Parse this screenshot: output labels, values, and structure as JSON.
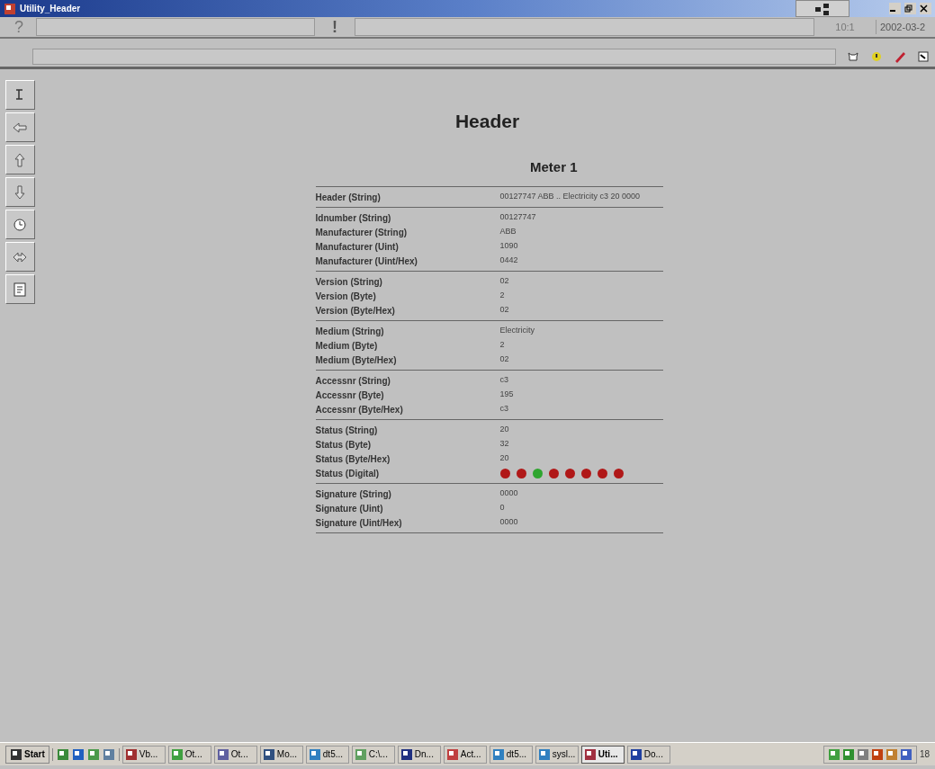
{
  "window": {
    "title": "Utility_Header"
  },
  "toolbar": {
    "help": "?",
    "alert": "!",
    "time": "10:1",
    "date": "2002-03-2"
  },
  "page": {
    "title": "Header",
    "subtitle": "Meter 1"
  },
  "sections": [
    {
      "rows": [
        {
          "kind": "text",
          "label": "Header (String)",
          "value": "00127747 ABB .. Electricity c3 20 0000"
        }
      ]
    },
    {
      "rows": [
        {
          "kind": "text",
          "label": "Idnumber (String)",
          "value": "00127747"
        },
        {
          "kind": "text",
          "label": "Manufacturer (String)",
          "value": "ABB"
        },
        {
          "kind": "text",
          "label": "Manufacturer (Uint)",
          "value": "1090"
        },
        {
          "kind": "text",
          "label": "Manufacturer (Uint/Hex)",
          "value": "0442"
        }
      ]
    },
    {
      "rows": [
        {
          "kind": "text",
          "label": "Version (String)",
          "value": "02"
        },
        {
          "kind": "text",
          "label": "Version (Byte)",
          "value": "2"
        },
        {
          "kind": "text",
          "label": "Version (Byte/Hex)",
          "value": "02"
        }
      ]
    },
    {
      "rows": [
        {
          "kind": "text",
          "label": "Medium (String)",
          "value": "Electricity"
        },
        {
          "kind": "text",
          "label": "Medium (Byte)",
          "value": "2"
        },
        {
          "kind": "text",
          "label": "Medium (Byte/Hex)",
          "value": "02"
        }
      ]
    },
    {
      "rows": [
        {
          "kind": "text",
          "label": "Accessnr (String)",
          "value": "c3"
        },
        {
          "kind": "text",
          "label": "Accessnr (Byte)",
          "value": "195"
        },
        {
          "kind": "text",
          "label": "Accessnr (Byte/Hex)",
          "value": "c3"
        }
      ]
    },
    {
      "rows": [
        {
          "kind": "text",
          "label": "Status (String)",
          "value": "20"
        },
        {
          "kind": "text",
          "label": "Status (Byte)",
          "value": "32"
        },
        {
          "kind": "text",
          "label": "Status (Byte/Hex)",
          "value": "20"
        },
        {
          "kind": "leds",
          "label": "Status (Digital)",
          "leds": [
            {
              "on": false
            },
            {
              "on": false
            },
            {
              "on": true
            },
            {
              "on": false
            },
            {
              "on": false
            },
            {
              "on": false
            },
            {
              "on": false
            },
            {
              "on": false
            }
          ]
        }
      ]
    },
    {
      "rows": [
        {
          "kind": "text",
          "label": "Signature (String)",
          "value": "0000"
        },
        {
          "kind": "text",
          "label": "Signature (Uint)",
          "value": "0"
        },
        {
          "kind": "text",
          "label": "Signature (Uint/Hex)",
          "value": "0000"
        }
      ]
    }
  ],
  "taskbar": {
    "start": "Start",
    "items": [
      {
        "label": "Vb...",
        "selected": false
      },
      {
        "label": "Ot...",
        "selected": false
      },
      {
        "label": "Ot...",
        "selected": false
      },
      {
        "label": "Mo...",
        "selected": false
      },
      {
        "label": "dt5...",
        "selected": false
      },
      {
        "label": "C:\\...",
        "selected": false
      },
      {
        "label": "Dn...",
        "selected": false
      },
      {
        "label": "Act...",
        "selected": false
      },
      {
        "label": "dt5...",
        "selected": false
      },
      {
        "label": "sysl...",
        "selected": false
      },
      {
        "label": "Uti...",
        "selected": true
      },
      {
        "label": "Do...",
        "selected": false
      }
    ],
    "clock": "18"
  }
}
